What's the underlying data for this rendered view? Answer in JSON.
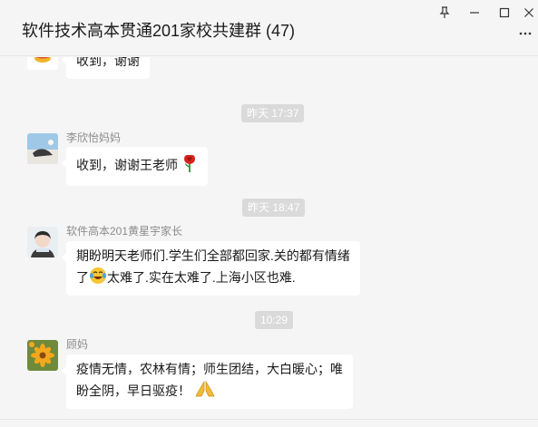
{
  "window": {
    "title": "软件技术高本贯通201家校共建群 (47)",
    "controls": {
      "pin_icon": "pin-icon",
      "minimize_icon": "minimize-icon",
      "maximize_icon": "maximize-icon",
      "close_icon": "close-icon",
      "more_icon": "more-icon"
    }
  },
  "messages": [
    {
      "type": "message",
      "sender": "",
      "text": "收到，谢谢"
    },
    {
      "type": "time",
      "text": "昨天 17:37"
    },
    {
      "type": "message",
      "sender": "李欣怡妈妈",
      "text": "收到，谢谢王老师",
      "trailing_emoji": "rose-emoji"
    },
    {
      "type": "time",
      "text": "昨天 18:47"
    },
    {
      "type": "message",
      "sender": "软件高本201黄星宇家长",
      "line1": "期盼明天老师们.学生们全部都回家.关的都有情绪",
      "line2_prefix": "了",
      "inline_emoji": "crying-laughing-emoji",
      "line2_suffix": "太难了.实在太难了.上海小区也难."
    },
    {
      "type": "time",
      "text": "10:29"
    },
    {
      "type": "message",
      "sender": "顾妈",
      "line1": "疫情无情，农林有情；师生团结，大白暖心；唯",
      "line2": "盼全阴，早日驱疫！",
      "trailing_emoji": "praying-hands-emoji"
    }
  ],
  "colors": {
    "background": "#f5f5f5",
    "bubble": "#ffffff",
    "time_badge": "#dadada",
    "sender_name": "#8c8c8c"
  }
}
